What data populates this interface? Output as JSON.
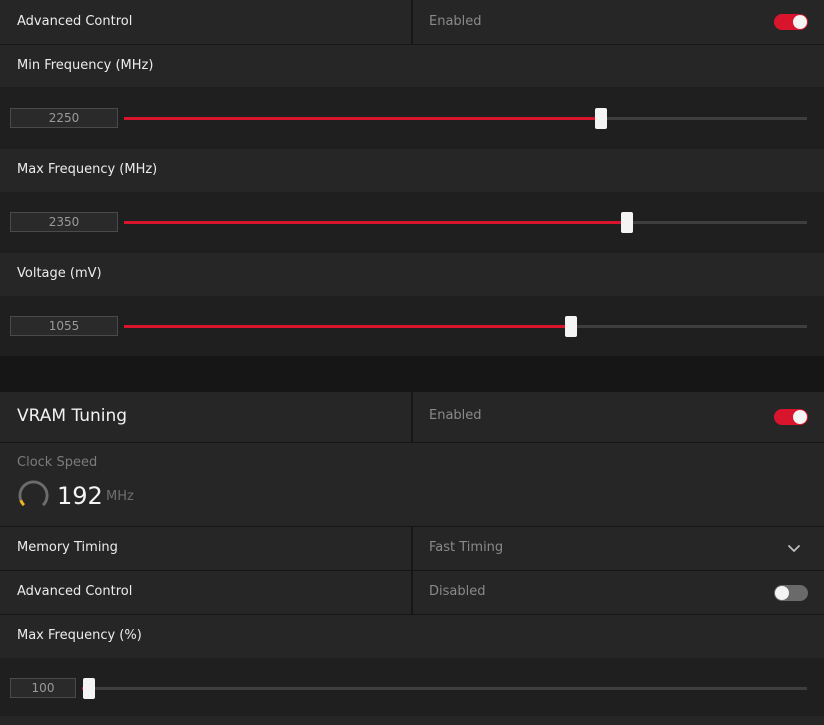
{
  "gpu_section": {
    "advanced_control": {
      "label": "Advanced Control",
      "status": "Enabled",
      "enabled": true
    },
    "min_frequency": {
      "label": "Min Frequency (MHz)",
      "value": "2250",
      "fraction": 0.698
    },
    "max_frequency": {
      "label": "Max Frequency (MHz)",
      "value": "2350",
      "fraction": 0.736
    },
    "voltage": {
      "label": "Voltage (mV)",
      "value": "1055",
      "fraction": 0.654
    }
  },
  "vram_section": {
    "title": "VRAM Tuning",
    "status": "Enabled",
    "enabled": true,
    "clock_speed": {
      "label": "Clock Speed",
      "value": "192",
      "unit": "MHz"
    },
    "memory_timing": {
      "label": "Memory Timing",
      "value": "Fast Timing"
    },
    "advanced_control": {
      "label": "Advanced Control",
      "status": "Disabled",
      "enabled": false
    },
    "max_frequency_pct": {
      "label": "Max Frequency (%)",
      "value": "100",
      "fraction": 0.01
    }
  },
  "colors": {
    "accent": "#d8152c",
    "gauge_arc": "#f0b41e",
    "panel": "#262626",
    "background": "#161616"
  },
  "icons": {
    "toggle": "toggle-switch",
    "dropdown": "chevron-down-icon",
    "gauge": "gauge-icon"
  }
}
